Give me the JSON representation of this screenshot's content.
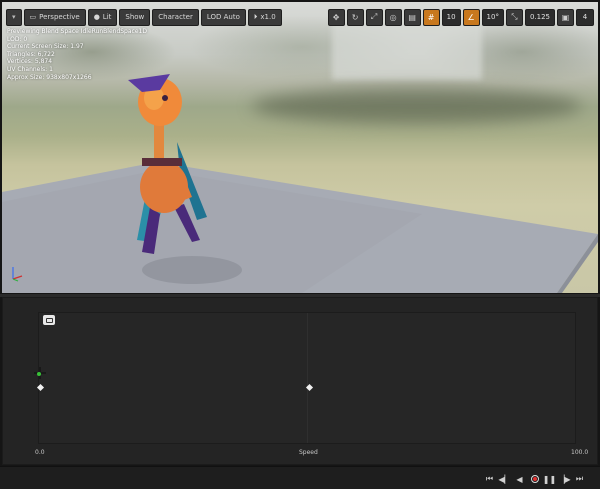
{
  "viewport": {
    "toolbar": {
      "menu_icon": "menu-dropdown-icon",
      "perspective_label": "Perspective",
      "lit_label": "Lit",
      "show_label": "Show",
      "character_label": "Character",
      "lod_label": "LOD Auto",
      "speed_label": "x1.0",
      "grid_snap_value": "10",
      "rotation_snap_value": "10°",
      "scale_snap_value": "0.125",
      "camera_speed_value": "4"
    },
    "stats": [
      "Previewing Blend Space IdleRunBlendSpace1D",
      "LOD: 0",
      "Current Screen Size: 1.97",
      "Triangles: 6,722",
      "Vertices: 5,874",
      "UV Channels: 1",
      "Approx Size: 938x807x1266"
    ]
  },
  "blend_space": {
    "axis_min": "0.0",
    "axis_name": "Speed",
    "axis_max": "100.0",
    "samples": [
      0,
      50
    ],
    "preview_value": 0
  },
  "transport": {
    "icons": [
      "to-start-icon",
      "step-back-icon",
      "play-reverse-icon",
      "record-icon",
      "pause-icon",
      "step-forward-icon",
      "to-end-icon"
    ]
  },
  "colors": {
    "accent": "#c8781e",
    "panel_bg": "#242424",
    "record": "#e03030"
  }
}
